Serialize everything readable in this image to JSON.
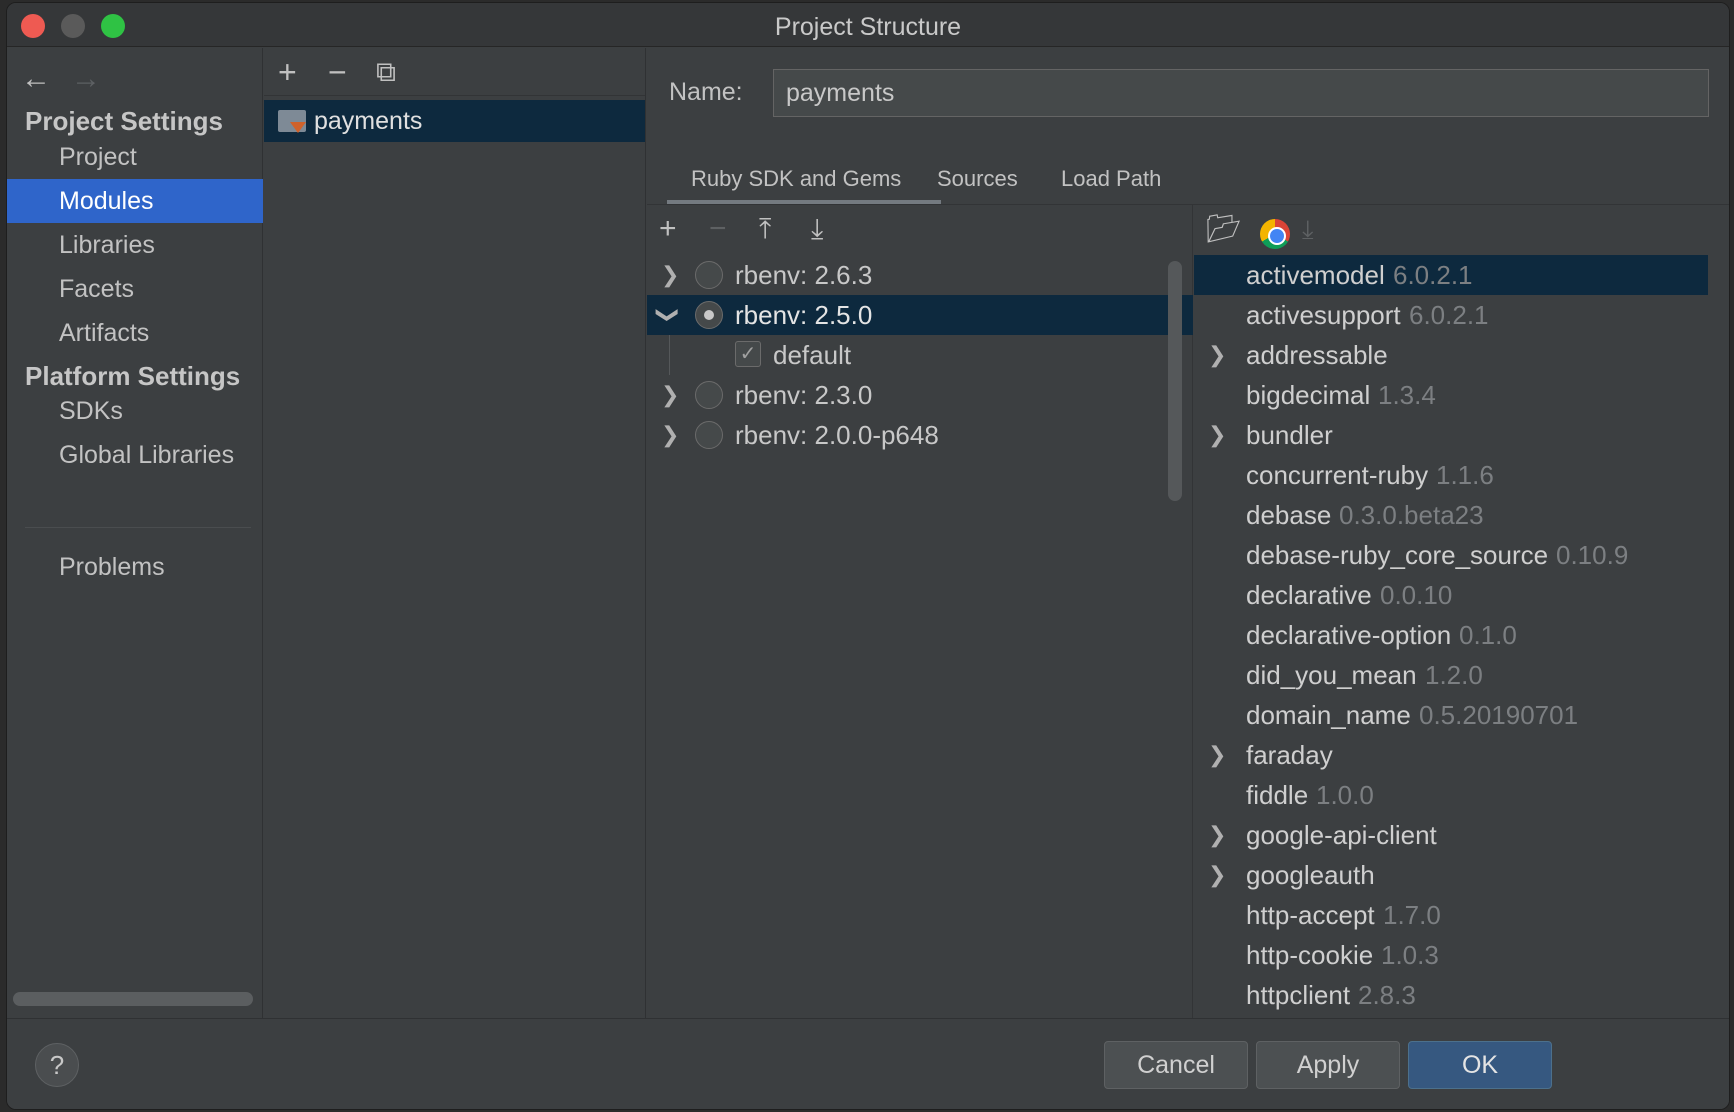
{
  "window": {
    "title": "Project Structure"
  },
  "nav": {
    "back": "←",
    "forward": "→"
  },
  "sidebar": {
    "project_settings_heading": "Project Settings",
    "platform_settings_heading": "Platform Settings",
    "items": [
      {
        "label": "Project"
      },
      {
        "label": "Modules",
        "selected": true
      },
      {
        "label": "Libraries"
      },
      {
        "label": "Facets"
      },
      {
        "label": "Artifacts"
      },
      {
        "label": "SDKs"
      },
      {
        "label": "Global Libraries"
      },
      {
        "label": "Problems"
      }
    ]
  },
  "modules": {
    "toolbar": {
      "add": "+",
      "remove": "−",
      "copy": "⧉"
    },
    "items": [
      {
        "label": "payments",
        "selected": true
      }
    ]
  },
  "module_detail": {
    "name_label": "Name:",
    "name_value": "payments",
    "tabs": [
      {
        "label": "Ruby SDK and Gems",
        "active": true
      },
      {
        "label": "Sources"
      },
      {
        "label": "Load Path"
      }
    ]
  },
  "sdk": {
    "toolbar": {
      "add": "+",
      "remove": "−",
      "expand_all": "⤒",
      "collapse_all": "⤓"
    },
    "items": [
      {
        "label": "rbenv: 2.6.3",
        "expanded": false,
        "selected": false
      },
      {
        "label": "rbenv: 2.5.0",
        "expanded": true,
        "selected": true
      },
      {
        "label": "default",
        "checked": true,
        "child": true
      },
      {
        "label": "rbenv: 2.3.0",
        "expanded": false,
        "selected": false
      },
      {
        "label": "rbenv: 2.0.0-p648",
        "expanded": false,
        "selected": false
      }
    ]
  },
  "gems": {
    "toolbar_icons": [
      "folder-open-icon",
      "chrome-icon",
      "download-icon"
    ],
    "items": [
      {
        "name": "activemodel",
        "version": "6.0.2.1",
        "selected": true,
        "expandable": false
      },
      {
        "name": "activesupport",
        "version": "6.0.2.1",
        "expandable": false
      },
      {
        "name": "addressable",
        "version": "",
        "expandable": true
      },
      {
        "name": "bigdecimal",
        "version": "1.3.4",
        "expandable": false
      },
      {
        "name": "bundler",
        "version": "",
        "expandable": true
      },
      {
        "name": "concurrent-ruby",
        "version": "1.1.6",
        "expandable": false
      },
      {
        "name": "debase",
        "version": "0.3.0.beta23",
        "expandable": false
      },
      {
        "name": "debase-ruby_core_source",
        "version": "0.10.9",
        "expandable": false
      },
      {
        "name": "declarative",
        "version": "0.0.10",
        "expandable": false
      },
      {
        "name": "declarative-option",
        "version": "0.1.0",
        "expandable": false
      },
      {
        "name": "did_you_mean",
        "version": "1.2.0",
        "expandable": false
      },
      {
        "name": "domain_name",
        "version": "0.5.20190701",
        "expandable": false
      },
      {
        "name": "faraday",
        "version": "",
        "expandable": true
      },
      {
        "name": "fiddle",
        "version": "1.0.0",
        "expandable": false
      },
      {
        "name": "google-api-client",
        "version": "",
        "expandable": true
      },
      {
        "name": "googleauth",
        "version": "",
        "expandable": true
      },
      {
        "name": "http-accept",
        "version": "1.7.0",
        "expandable": false
      },
      {
        "name": "http-cookie",
        "version": "1.0.3",
        "expandable": false
      },
      {
        "name": "httpclient",
        "version": "2.8.3",
        "expandable": false
      }
    ]
  },
  "footer": {
    "help": "?",
    "cancel": "Cancel",
    "apply": "Apply",
    "ok": "OK"
  },
  "colors": {
    "selection_sidebar": "#2f65ca",
    "selection_tree": "#0d293e",
    "primary_button": "#365880",
    "close": "#ee5a52",
    "maximize": "#2fc244"
  }
}
